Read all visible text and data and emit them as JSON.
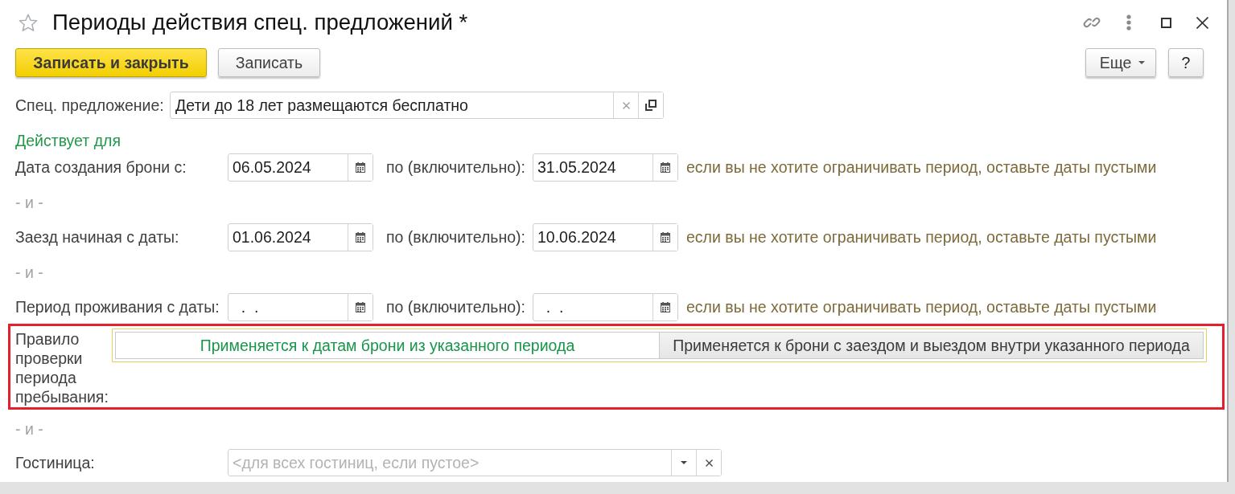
{
  "window": {
    "title": "Периоды действия спец. предложений *",
    "favorite": false
  },
  "toolbar": {
    "left": [
      {
        "label": "Записать и закрыть",
        "kind": "save_close"
      },
      {
        "label": "Записать",
        "kind": "save"
      }
    ],
    "right": [
      {
        "label": "Еще",
        "kind": "more"
      },
      {
        "label": "?",
        "kind": "help"
      }
    ]
  },
  "special_offer": {
    "label": "Спец. предложение:",
    "value": "Дети до 18 лет размещаются бесплатно"
  },
  "section_title": "Действует для",
  "rows": [
    {
      "kind": "date_range",
      "label": "Дата создания брони с:",
      "from": "06.05.2024",
      "to_label": "по (включительно):",
      "to": "31.05.2024",
      "hint": "если вы не хотите ограничивать период, оставьте даты пустыми"
    },
    {
      "kind": "separator",
      "text": "- и -"
    },
    {
      "kind": "date_range",
      "label": "Заезд начиная с даты:",
      "from": "01.06.2024",
      "to_label": "по (включительно):",
      "to": "10.06.2024",
      "hint": "если вы не хотите ограничивать период, оставьте даты пустыми"
    },
    {
      "kind": "separator",
      "text": "- и -"
    },
    {
      "kind": "date_range",
      "label": "Период проживания с даты:",
      "from": "  .  .",
      "to_label": "по (включительно):",
      "to": "  .  .",
      "hint": "если вы не хотите ограничивать период, оставьте даты пустыми"
    },
    {
      "kind": "toggle",
      "label": "Правило проверки периода пребывания:",
      "highlighted": true,
      "options": [
        {
          "label": "Применяется к датам брони из указанного периода",
          "selected": true
        },
        {
          "label": "Применяется к брони с заездом и выездом внутри указанного периода",
          "selected": false
        }
      ]
    },
    {
      "kind": "separator",
      "text": "- и -"
    },
    {
      "kind": "select",
      "label": "Гостиница:",
      "placeholder": "<для всех гостиниц, если пустое>"
    }
  ]
}
